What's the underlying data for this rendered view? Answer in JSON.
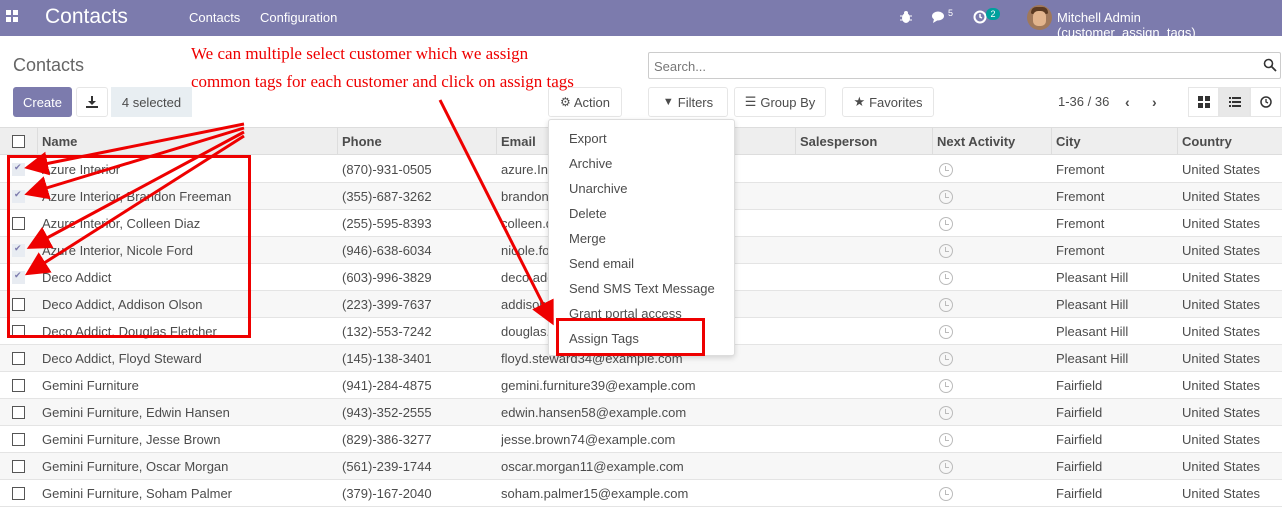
{
  "navbar": {
    "app_title": "Contacts",
    "menu": [
      "Contacts",
      "Configuration"
    ],
    "messages_count": "5",
    "activities_count": "2",
    "user_name": "Mitchell Admin (customer_assign_tags)",
    "bg_color": "#7c7bad"
  },
  "control_panel": {
    "breadcrumb": "Contacts",
    "create_label": "Create",
    "selected_label": "4 selected",
    "action_label": "Action",
    "search_placeholder": "Search...",
    "filters_label": "Filters",
    "groupby_label": "Group By",
    "favorites_label": "Favorites",
    "pager": "1-36 / 36"
  },
  "table": {
    "columns": [
      "Name",
      "Phone",
      "Email",
      "Salesperson",
      "Next Activity",
      "City",
      "Country"
    ],
    "rows": [
      {
        "checked": true,
        "name": "Azure Interior",
        "phone": "(870)-931-0505",
        "email": "azure.Interior24@example.com",
        "city": "Fremont",
        "country": "United States"
      },
      {
        "checked": true,
        "name": "Azure Interior, Brandon Freeman",
        "phone": "(355)-687-3262",
        "email": "brandon.freeman55@example.com",
        "city": "Fremont",
        "country": "United States"
      },
      {
        "checked": false,
        "name": "Azure Interior, Colleen Diaz",
        "phone": "(255)-595-8393",
        "email": "colleen.diaz83@example.com",
        "city": "Fremont",
        "country": "United States"
      },
      {
        "checked": true,
        "name": "Azure Interior, Nicole Ford",
        "phone": "(946)-638-6034",
        "email": "nicole.ford75@example.com",
        "city": "Fremont",
        "country": "United States"
      },
      {
        "checked": true,
        "name": "Deco Addict",
        "phone": "(603)-996-3829",
        "email": "deco.addict82@example.com",
        "city": "Pleasant Hill",
        "country": "United States"
      },
      {
        "checked": false,
        "name": "Deco Addict, Addison Olson",
        "phone": "(223)-399-7637",
        "email": "addison.olson28@example.com",
        "city": "Pleasant Hill",
        "country": "United States"
      },
      {
        "checked": false,
        "name": "Deco Addict, Douglas Fletcher",
        "phone": "(132)-553-7242",
        "email": "douglas.fletcher51@example.com",
        "city": "Pleasant Hill",
        "country": "United States"
      },
      {
        "checked": false,
        "name": "Deco Addict, Floyd Steward",
        "phone": "(145)-138-3401",
        "email": "floyd.steward34@example.com",
        "city": "Pleasant Hill",
        "country": "United States"
      },
      {
        "checked": false,
        "name": "Gemini Furniture",
        "phone": "(941)-284-4875",
        "email": "gemini.furniture39@example.com",
        "city": "Fairfield",
        "country": "United States"
      },
      {
        "checked": false,
        "name": "Gemini Furniture, Edwin Hansen",
        "phone": "(943)-352-2555",
        "email": "edwin.hansen58@example.com",
        "city": "Fairfield",
        "country": "United States"
      },
      {
        "checked": false,
        "name": "Gemini Furniture, Jesse Brown",
        "phone": "(829)-386-3277",
        "email": "jesse.brown74@example.com",
        "city": "Fairfield",
        "country": "United States"
      },
      {
        "checked": false,
        "name": "Gemini Furniture, Oscar Morgan",
        "phone": "(561)-239-1744",
        "email": "oscar.morgan11@example.com",
        "city": "Fairfield",
        "country": "United States"
      },
      {
        "checked": false,
        "name": "Gemini Furniture, Soham Palmer",
        "phone": "(379)-167-2040",
        "email": "soham.palmer15@example.com",
        "city": "Fairfield",
        "country": "United States"
      }
    ]
  },
  "action_menu": {
    "items": [
      "Export",
      "Archive",
      "Unarchive",
      "Delete",
      "Merge",
      "Send email",
      "Send SMS Text Message",
      "Grant portal access",
      "Assign Tags"
    ]
  },
  "annotation": {
    "line1": "We can multiple select customer which we assign",
    "line2": "common tags for each customer and click on assign tags",
    "color": "#e00000"
  }
}
